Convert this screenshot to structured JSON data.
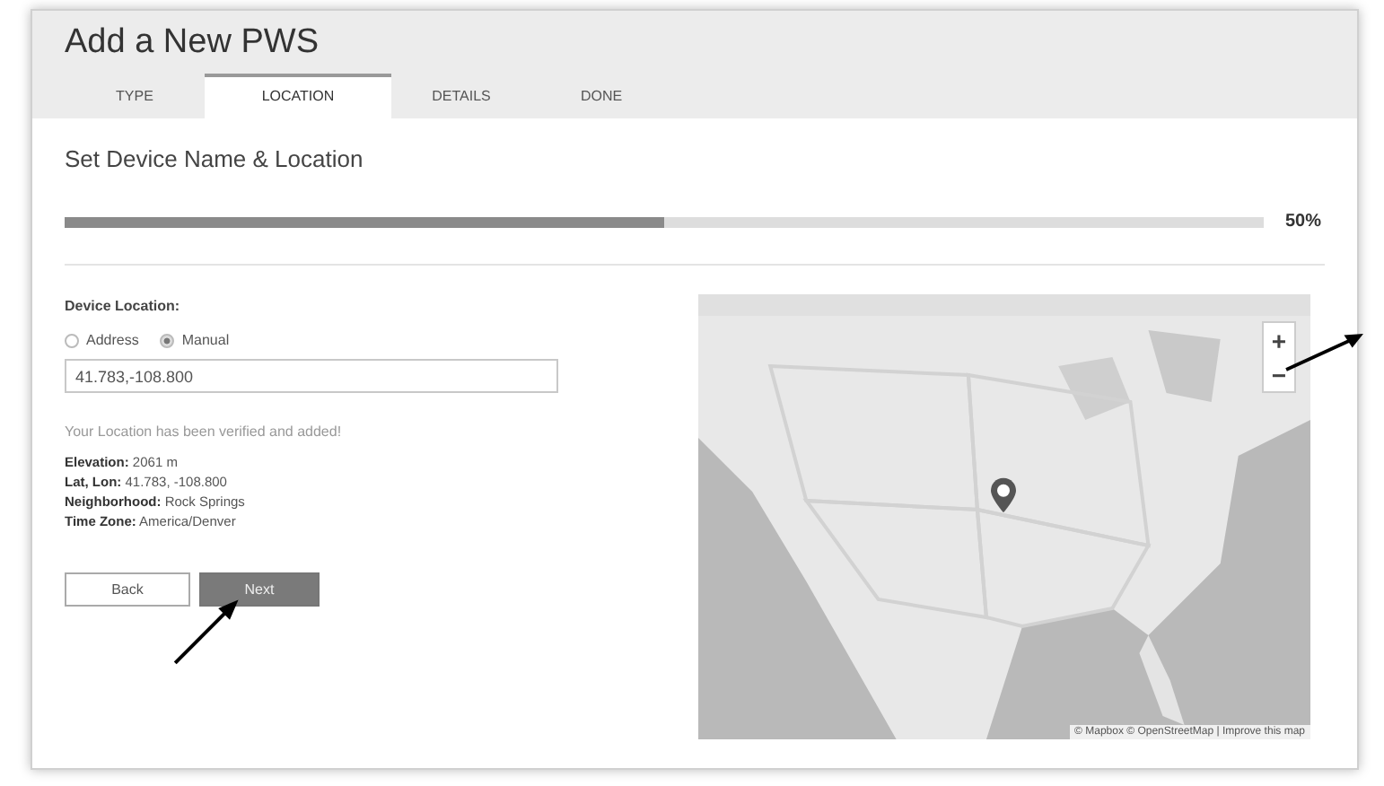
{
  "window": {
    "title": "Add a New PWS"
  },
  "tabs": [
    {
      "label": "TYPE",
      "selected": false
    },
    {
      "label": "LOCATION",
      "selected": true
    },
    {
      "label": "DETAILS",
      "selected": false
    },
    {
      "label": "DONE",
      "selected": false
    }
  ],
  "section_title": "Set Device Name & Location",
  "progress": {
    "level": 0.5,
    "reading": "50%"
  },
  "device_location": {
    "label": "Device Location:",
    "options": [
      {
        "label": "Address",
        "selected": false
      },
      {
        "label": "Manual",
        "selected": true
      }
    ],
    "field": {
      "value": "41.783,-108.800"
    }
  },
  "verified_message": "Your Location has been verified and added!",
  "details": [
    "**Elevation:** 2061 m",
    "**Lat, Lon:** 41.783, -108.800",
    "**Neighborhood:** Rock Springs",
    "**Time Zone:** America/Denver"
  ],
  "buttons": [
    {
      "label": "Back",
      "kind": "secondary"
    },
    {
      "label": "Next",
      "kind": "primary"
    }
  ],
  "map": {
    "zoom_controls": [
      "+",
      "−"
    ],
    "attribution": "© Mapbox © OpenStreetMap | Improve this map"
  }
}
